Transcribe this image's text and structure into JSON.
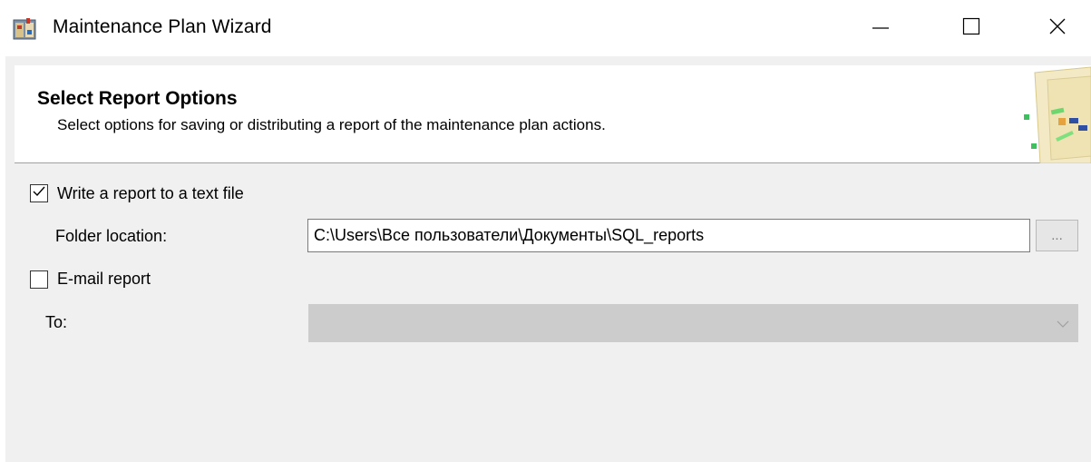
{
  "window": {
    "title": "Maintenance Plan Wizard",
    "icon": "maintenance-plan-wizard-icon",
    "controls": [
      "minimize-icon",
      "maximize-icon",
      "close-icon"
    ]
  },
  "header": {
    "title": "Select Report Options",
    "description": "Select options for saving or distributing a report of the maintenance plan actions.",
    "art": "wizard-banner-graphic"
  },
  "write_report": {
    "label": "Write a report to a text file",
    "checked": true,
    "folder_label": "Folder location:",
    "folder_value": "C:\\Users\\Все пользователи\\Документы\\SQL_reports",
    "browse_label": "..."
  },
  "email_report": {
    "label": "E-mail report",
    "checked": false,
    "to_label": "To:",
    "to_value": "",
    "to_enabled": false
  },
  "colors": {
    "dialog_bg": "#f0f0f0",
    "header_bg": "#ffffff",
    "disabled_field": "#cccccc"
  }
}
